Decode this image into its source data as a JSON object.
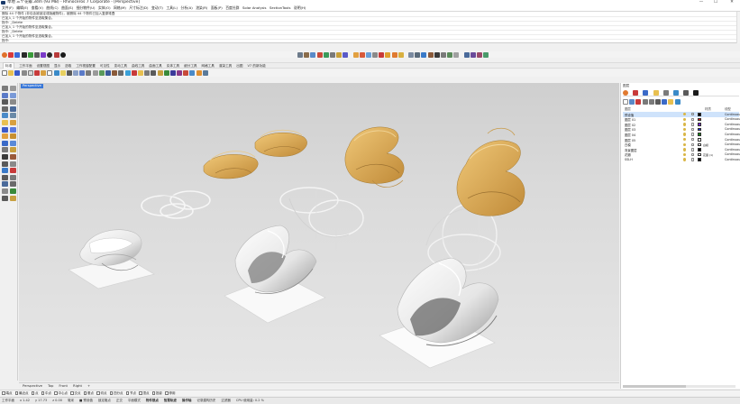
{
  "window": {
    "title": "草地 三个花瓣.3dm (93 MB) - Rhinoceros 7 Corporate - [Perspective]",
    "minimize": "—",
    "maximize": "☐",
    "close": "✕"
  },
  "menu": [
    "文件(F)",
    "编辑(E)",
    "查看(V)",
    "曲线(C)",
    "曲面(S)",
    "细分物件(U)",
    "实体(O)",
    "网格(M)",
    "尺寸标注(D)",
    "变动(T)",
    "工具(L)",
    "分析(A)",
    "渲染(R)",
    "面板(P)",
    "百度社群",
    "Solar Analysis",
    "SectionTools",
    "说明(H)"
  ],
  "history": [
    "删除 44 个物件 (非包含被锁定或隐藏物件)，被删除 44 个物件已加入复原堆叠",
    "已加入 1 个开始的物件至选取集合。",
    "指令: _Delete",
    "已加入 1 个开始的物件至选取集合。",
    "指令: _Delete",
    "已加入 1 个开始的物件至选取集合。",
    "指令: _Delete",
    "指令:"
  ],
  "tabs": [
    "标准",
    "工作平面",
    "设置视图",
    "显示",
    "选取",
    "工作视窗配置",
    "可见性",
    "变动工具",
    "曲线工具",
    "曲面工具",
    "实体工具",
    "细分工具",
    "网格工具",
    "渲染工具",
    "出图",
    "V7 的新功能"
  ],
  "viewport": {
    "title": "Perspective",
    "tabs": [
      "Perspective",
      "Top",
      "Front",
      "Right",
      "+"
    ]
  },
  "right_panel": {
    "title": "图层",
    "col_material": "材质",
    "col_linetype": "线型",
    "layers": [
      {
        "name": "预设值",
        "color": "#000000",
        "material": "",
        "linetype": "Continuous",
        "selected": true
      },
      {
        "name": "图层 01",
        "color": "#d01818",
        "material": "",
        "linetype": "Continuous"
      },
      {
        "name": "图层 02",
        "color": "#7a2ad8",
        "material": "",
        "linetype": "Continuous"
      },
      {
        "name": "图层 03",
        "color": "#1c2fd6",
        "material": "",
        "linetype": "Continuous"
      },
      {
        "name": "图层 04",
        "color": "#1a8a1a",
        "material": "",
        "linetype": "Continuous"
      },
      {
        "name": "图层 05",
        "color": "#ffffff",
        "material": "",
        "linetype": "Continuous"
      },
      {
        "name": "白模",
        "color": "#ffffff",
        "material": "白模",
        "linetype": "Continuous"
      },
      {
        "name": "背景图层",
        "color": "#000000",
        "material": "",
        "linetype": "Continuous"
      },
      {
        "name": "花瓣",
        "color": "#ffffff",
        "material": "花瓣 (1)",
        "linetype": "Continuous"
      },
      {
        "name": "SSLH",
        "color": "#000000",
        "material": "",
        "linetype": "Continuous"
      }
    ]
  },
  "osnap": [
    "端点",
    "最近点",
    "点",
    "中点",
    "中心点",
    "交点",
    "垂点",
    "切点",
    "四分点",
    "节点",
    "顶点",
    "投影",
    "停用"
  ],
  "status": {
    "plane": "工作平面",
    "x": "x 1.42",
    "y": "y 17.73",
    "z": "z 0.00",
    "unit": "毫米",
    "layer": "■ 预设值",
    "items": [
      "锁定格点",
      "正交",
      "平面模式",
      "物件锁点",
      "智慧轨迹",
      "操作轴",
      "记录建构历史",
      "过滤器",
      "CPU 使用量: 0.2 %"
    ]
  },
  "colors": {
    "petal": "#d9aa5a",
    "petal_dark": "#b98a3e",
    "white_model": "#ffffff",
    "wire": "#eeeeee",
    "active_tab": "#3a78d8"
  }
}
